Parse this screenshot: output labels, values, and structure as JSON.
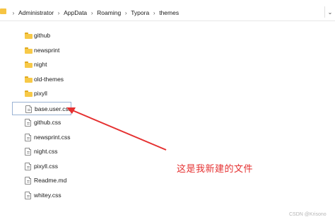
{
  "breadcrumb": [
    "Administrator",
    "AppData",
    "Roaming",
    "Typora",
    "themes"
  ],
  "files": [
    {
      "name": "github",
      "type": "folder"
    },
    {
      "name": "newsprint",
      "type": "folder"
    },
    {
      "name": "night",
      "type": "folder"
    },
    {
      "name": "old-themes",
      "type": "folder"
    },
    {
      "name": "pixyll",
      "type": "folder"
    },
    {
      "name": "base.user.css",
      "type": "css",
      "selected": true
    },
    {
      "name": "github.css",
      "type": "css"
    },
    {
      "name": "newsprint.css",
      "type": "css"
    },
    {
      "name": "night.css",
      "type": "css"
    },
    {
      "name": "pixyll.css",
      "type": "css"
    },
    {
      "name": "Readme.md",
      "type": "md"
    },
    {
      "name": "whitey.css",
      "type": "css"
    }
  ],
  "annotation": "这是我新建的文件",
  "watermark": "CSDN @Krisono",
  "colors": {
    "annotation": "#e53030",
    "folder": "#f7c948",
    "selection_border": "#9ab3d4"
  },
  "icons": {
    "folder": "folder-icon",
    "file": "file-icon",
    "separator": "chevron-right-icon",
    "dropdown": "chevron-down-icon"
  }
}
